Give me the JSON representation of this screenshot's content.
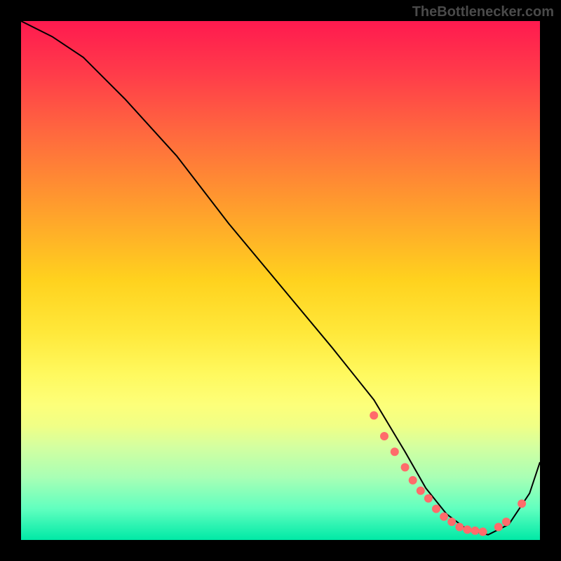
{
  "attribution": "TheBottlenecker.com",
  "chart_data": {
    "type": "line",
    "title": "",
    "xlabel": "",
    "ylabel": "",
    "xlim": [
      0,
      100
    ],
    "ylim": [
      0,
      100
    ],
    "series": [
      {
        "name": "curve",
        "x": [
          0,
          6,
          12,
          20,
          30,
          40,
          50,
          60,
          68,
          74,
          78,
          82,
          86,
          90,
          94,
          98,
          100
        ],
        "values": [
          100,
          97,
          93,
          85,
          74,
          61,
          49,
          37,
          27,
          17,
          10,
          5,
          2,
          1,
          3,
          9,
          15
        ]
      }
    ],
    "markers": {
      "x": [
        68.0,
        70.0,
        72.0,
        74.0,
        75.5,
        77.0,
        78.5,
        80.0,
        81.5,
        83.0,
        84.5,
        86.0,
        87.5,
        89.0,
        92.0,
        93.5,
        96.5
      ],
      "values": [
        24.0,
        20.0,
        17.0,
        14.0,
        11.5,
        9.5,
        8.0,
        6.0,
        4.5,
        3.5,
        2.5,
        2.0,
        1.8,
        1.6,
        2.5,
        3.5,
        7.0
      ]
    },
    "marker_color": "#ff6b6b",
    "curve_color": "#000000"
  }
}
